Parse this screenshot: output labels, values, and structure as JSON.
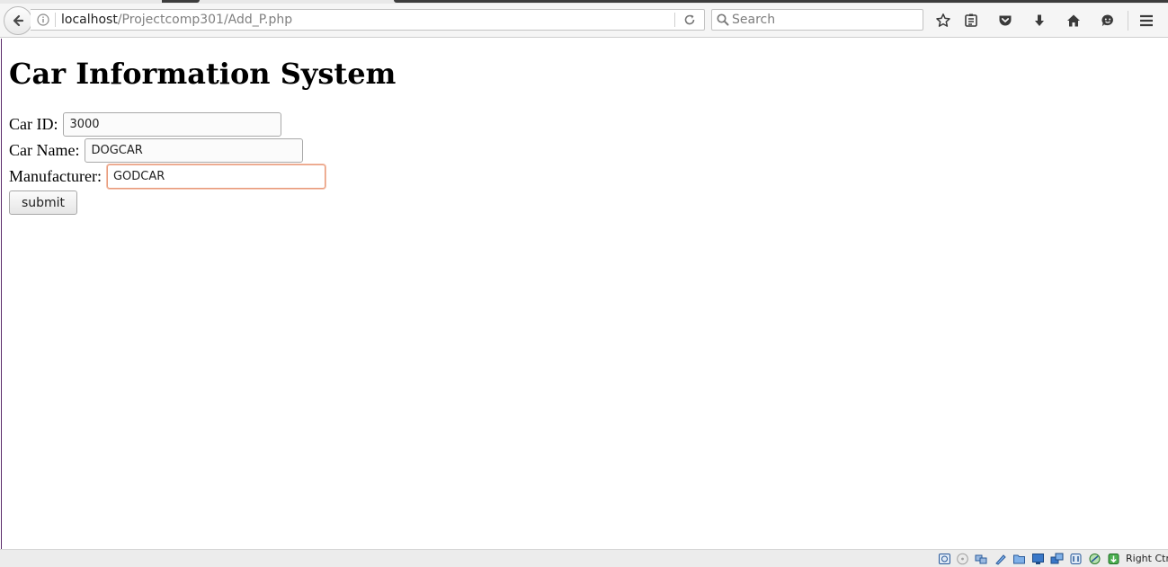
{
  "browser": {
    "url_host": "localhost",
    "url_path": "/Projectcomp301/Add_P.php",
    "search_placeholder": "Search"
  },
  "page": {
    "title": "Car Information System",
    "form": {
      "fields": [
        {
          "label": "Car ID:",
          "value": "3000"
        },
        {
          "label": "Car Name:",
          "value": "DOGCAR"
        },
        {
          "label": "Manufacturer:",
          "value": "GODCAR"
        }
      ],
      "submit_label": "submit"
    }
  },
  "statusbar": {
    "host_key_label": "Right Ctrl"
  },
  "colors": {
    "focus_border": "#e89a7a",
    "toolbar_bg": "#f5f5f5"
  }
}
